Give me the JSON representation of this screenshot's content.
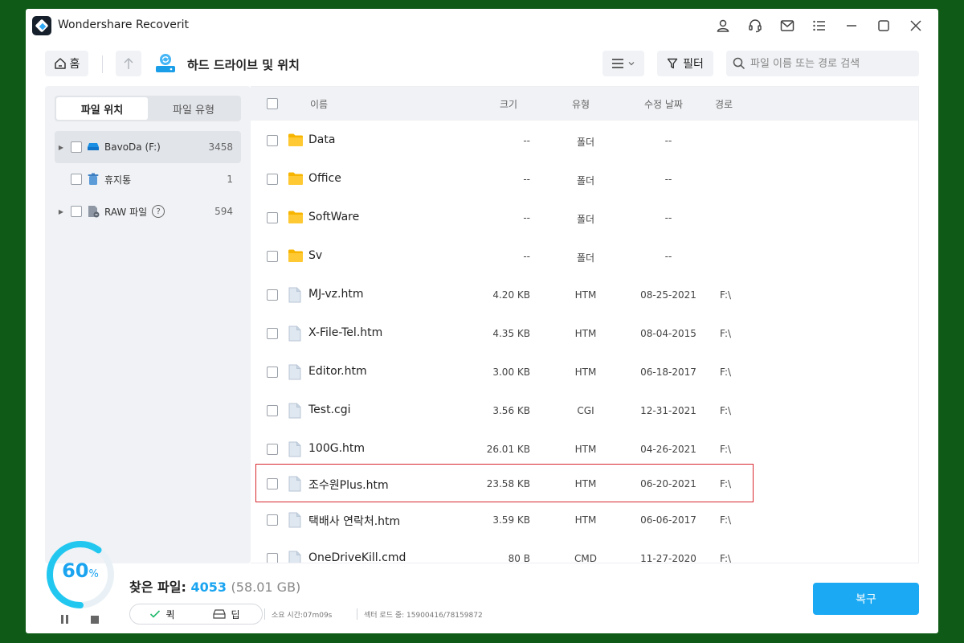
{
  "app": {
    "title": "Wondershare Recoverit",
    "titlebar_icons": [
      "user-icon",
      "headset-icon",
      "mail-icon",
      "menu-icon",
      "minimize-icon",
      "maximize-icon",
      "close-icon"
    ]
  },
  "toolbar": {
    "home_label": "홈",
    "location_title": "하드 드라이브 및 위치",
    "filter_label": "필터",
    "search_placeholder": "파일 이름 또는 경로 검색"
  },
  "sidebar": {
    "tabs": [
      {
        "label": "파일 위치",
        "active": true
      },
      {
        "label": "파일 유형",
        "active": false
      }
    ],
    "items": [
      {
        "label": "BavoDa (F:)",
        "count": "3458",
        "icon": "drive-icon",
        "selected": true,
        "expandable": true
      },
      {
        "label": "휴지통",
        "count": "1",
        "icon": "trash-icon",
        "selected": false,
        "expandable": false
      },
      {
        "label": "RAW 파일",
        "count": "594",
        "icon": "raw-file-icon",
        "selected": false,
        "expandable": true
      }
    ]
  },
  "table": {
    "columns": {
      "name": "이름",
      "size": "크기",
      "type": "유형",
      "modified": "수정 날짜",
      "path": "경로"
    },
    "rows": [
      {
        "name": "Data",
        "size": "--",
        "type": "폴더",
        "date": "--",
        "path": "",
        "icon": "folder-icon"
      },
      {
        "name": "Office",
        "size": "--",
        "type": "폴더",
        "date": "--",
        "path": "",
        "icon": "folder-icon"
      },
      {
        "name": "SoftWare",
        "size": "--",
        "type": "폴더",
        "date": "--",
        "path": "",
        "icon": "folder-icon"
      },
      {
        "name": "Sv",
        "size": "--",
        "type": "폴더",
        "date": "--",
        "path": "",
        "icon": "folder-icon"
      },
      {
        "name": "MJ-vz.htm",
        "size": "4.20 KB",
        "type": "HTM",
        "date": "08-25-2021",
        "path": "F:\\",
        "icon": "file-icon"
      },
      {
        "name": "X-File-Tel.htm",
        "size": "4.35 KB",
        "type": "HTM",
        "date": "08-04-2015",
        "path": "F:\\",
        "icon": "file-icon"
      },
      {
        "name": "Editor.htm",
        "size": "3.00 KB",
        "type": "HTM",
        "date": "06-18-2017",
        "path": "F:\\",
        "icon": "file-icon"
      },
      {
        "name": "Test.cgi",
        "size": "3.56 KB",
        "type": "CGI",
        "date": "12-31-2021",
        "path": "F:\\",
        "icon": "file-icon"
      },
      {
        "name": "100G.htm",
        "size": "26.01 KB",
        "type": "HTM",
        "date": "04-26-2021",
        "path": "F:\\",
        "icon": "file-icon"
      },
      {
        "name": "조수원Plus.htm",
        "size": "23.58 KB",
        "type": "HTM",
        "date": "06-20-2021",
        "path": "F:\\",
        "icon": "file-icon"
      },
      {
        "name": "택배사 연락처.htm",
        "size": "3.59 KB",
        "type": "HTM",
        "date": "06-06-2017",
        "path": "F:\\",
        "icon": "file-icon"
      },
      {
        "name": "OneDriveKill.cmd",
        "size": "80 B",
        "type": "CMD",
        "date": "11-27-2020",
        "path": "F:\\",
        "icon": "file-icon"
      }
    ]
  },
  "status": {
    "progress_value": "60",
    "progress_unit": "%",
    "progress_fraction": 0.6,
    "found_label": "찾은 파일:",
    "found_count": "4053",
    "found_size": "(58.01 GB)",
    "quick_label": "퀵",
    "deep_label": "딥",
    "elapsed": "소요 시간:07m09s",
    "sectors": "섹터 로드 중: 15900416/78159872",
    "recover_label": "복구"
  },
  "colors": {
    "accent": "#1aa9f2",
    "folder": "#f7b500",
    "highlight_border": "#d8282e",
    "background": "#0e5a16"
  }
}
